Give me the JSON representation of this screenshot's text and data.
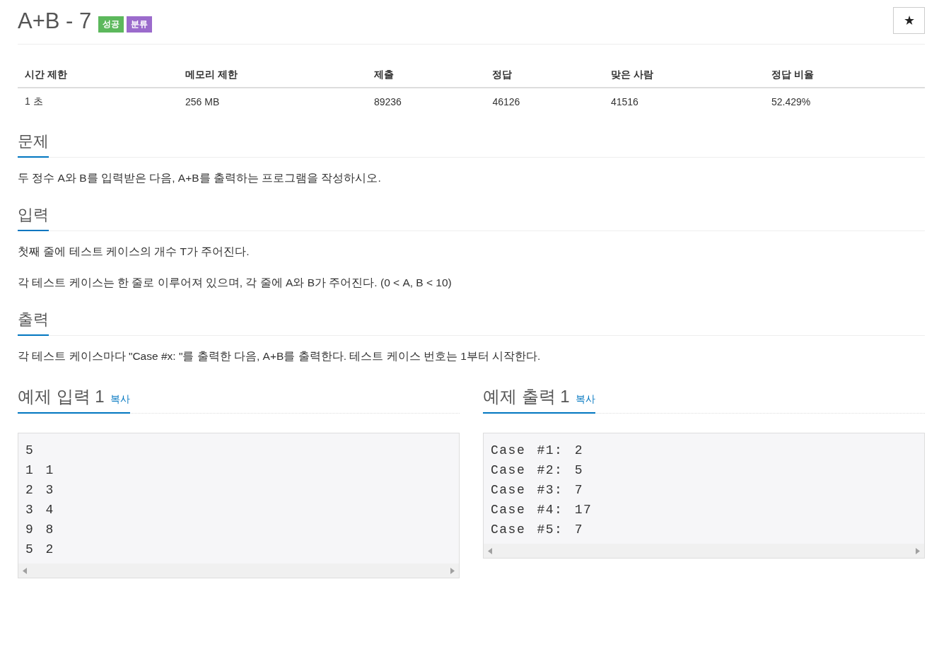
{
  "title": "A+B - 7",
  "badges": [
    {
      "label": "성공",
      "color": "#5cb85c"
    },
    {
      "label": "분류",
      "color": "#9b6bcc"
    }
  ],
  "star_button": {
    "label": "★"
  },
  "stats": {
    "columns": [
      "시간 제한",
      "메모리 제한",
      "제출",
      "정답",
      "맞은 사람",
      "정답 비율"
    ],
    "row": [
      "1 초",
      "256 MB",
      "89236",
      "46126",
      "41516",
      "52.429%"
    ]
  },
  "sections": [
    {
      "heading": "문제",
      "paragraphs": [
        "두 정수 A와 B를 입력받은 다음, A+B를 출력하는 프로그램을 작성하시오."
      ]
    },
    {
      "heading": "입력",
      "paragraphs": [
        "첫째 줄에 테스트 케이스의 개수 T가 주어진다.",
        "각 테스트 케이스는 한 줄로 이루어져 있으며, 각 줄에 A와 B가 주어진다. (0 < A, B < 10)"
      ]
    },
    {
      "heading": "출력",
      "paragraphs": [
        "각 테스트 케이스마다 \"Case #x: \"를 출력한 다음, A+B를 출력한다. 테스트 케이스 번호는 1부터 시작한다."
      ]
    }
  ],
  "samples": [
    {
      "heading": "예제 입력 1",
      "copy": "복사",
      "lines": [
        "5",
        "1 1",
        "2 3",
        "3 4",
        "9 8",
        "5 2"
      ]
    },
    {
      "heading": "예제 출력 1",
      "copy": "복사",
      "lines": [
        "Case #1: 2",
        "Case #2: 5",
        "Case #3: 7",
        "Case #4: 17",
        "Case #5: 7"
      ]
    }
  ]
}
